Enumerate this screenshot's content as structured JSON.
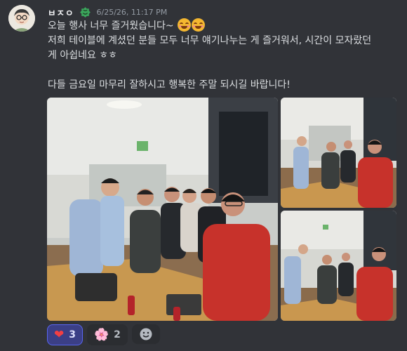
{
  "message": {
    "author": "ㅂㅈㅇ",
    "timestamp": "6/25/26, 11:17 PM",
    "lines": [
      "오늘 행사 너무 즐거웠습니다~",
      "저희 테이블에 계셨던 분들 모두 너무 얘기나누는 게 즐거워서, 시간이 모자랐던",
      "게 아쉽네요 ㅎㅎ",
      "",
      "다들 금요일 마무리 잘하시고 행복한 주말 되시길 바랍니다!"
    ],
    "trailing_emoji": [
      "smiling-face-with-smiling-eyes",
      "smiling-face-with-smiling-eyes"
    ]
  },
  "attachments": [
    {
      "kind": "photo",
      "description_name": "group-photo-large"
    },
    {
      "kind": "photo",
      "description_name": "group-photo-top-right"
    },
    {
      "kind": "photo",
      "description_name": "group-photo-bottom-right"
    }
  ],
  "reactions": [
    {
      "emoji": "❤",
      "icon": "heart-icon",
      "count": "3",
      "selected": true
    },
    {
      "emoji": "🌸",
      "icon": "cherry-blossom-icon",
      "count": "2",
      "selected": false
    }
  ],
  "colors": {
    "background": "#313338",
    "accent": "#5865f2",
    "badge": "#3ba55c"
  }
}
